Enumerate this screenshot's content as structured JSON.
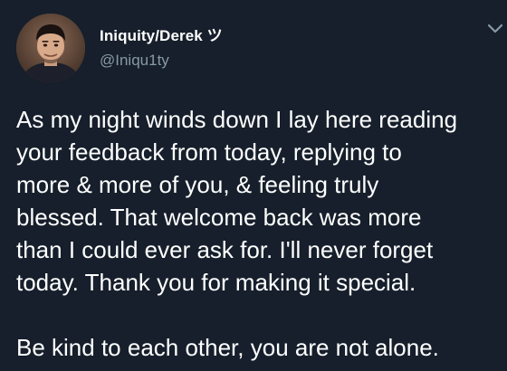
{
  "tweet": {
    "display_name": "Iniquity/Derek ツ",
    "handle": "@Iniqu1ty",
    "lines": [
      "As my night winds down I lay here reading",
      "your feedback from today, replying to",
      "more & more of you, & feeling truly",
      "blessed. That welcome back was more",
      "than I could ever ask for. I'll never forget",
      "today. Thank you for making it special."
    ],
    "closing_line": "Be kind to each other, you are not alone."
  },
  "icons": {
    "avatar": "profile-photo",
    "menu": "chevron-down-icon"
  },
  "colors": {
    "background": "#161f2b",
    "text": "#ffffff",
    "secondary_text": "#8899a6"
  }
}
